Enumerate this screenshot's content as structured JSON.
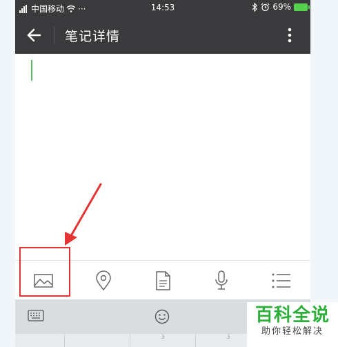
{
  "status_bar": {
    "carrier": "中国移动",
    "dots": "···",
    "time": "14:53",
    "battery_pct": "69%",
    "icons": [
      "signal-icon",
      "wifi-icon",
      "bluetooth-icon",
      "alarm-icon",
      "battery-icon"
    ]
  },
  "app_bar": {
    "title": "笔记详情",
    "back_icon": "arrow-left-icon",
    "more_icon": "more-vertical-icon"
  },
  "editor": {
    "value": ""
  },
  "toolbar": {
    "tools": [
      "image-icon",
      "location-icon",
      "document-icon",
      "microphone-icon",
      "list-icon"
    ]
  },
  "keyboard": {
    "tools": [
      "keyboard-icon",
      "emoji-icon"
    ],
    "key_hints": [
      "3",
      "3"
    ]
  },
  "watermark": {
    "main": "百科全说",
    "sub": "助你轻松解决"
  },
  "colors": {
    "app_bar_bg": "#3a3a3c",
    "accent_cursor": "#5cb85c",
    "annotation_red": "#e53333",
    "watermark_green": "#2eae3a"
  }
}
